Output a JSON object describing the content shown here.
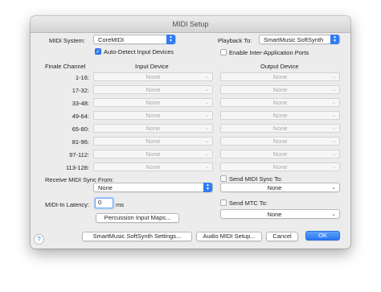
{
  "window": {
    "title": "MIDI Setup"
  },
  "top": {
    "midi_system_label": "MIDI System:",
    "midi_system_value": "CoreMIDI",
    "auto_detect_label": "Auto-Detect Input Devices",
    "auto_detect_checked": true,
    "playback_to_label": "Playback To:",
    "playback_to_value": "SmartMusic SoftSynth",
    "enable_iap_label": "Enable Inter-Application Ports",
    "enable_iap_checked": false
  },
  "table": {
    "col_channel": "Finale Channel",
    "col_input": "Input Device",
    "col_output": "Output Device",
    "rows": [
      {
        "channel": "1-16:",
        "input": "None",
        "output": "None"
      },
      {
        "channel": "17-32:",
        "input": "None",
        "output": "None"
      },
      {
        "channel": "33-48:",
        "input": "None",
        "output": "None"
      },
      {
        "channel": "49-64:",
        "input": "None",
        "output": "None"
      },
      {
        "channel": "65-80:",
        "input": "None",
        "output": "None"
      },
      {
        "channel": "81-96:",
        "input": "None",
        "output": "None"
      },
      {
        "channel": "97-112:",
        "input": "None",
        "output": "None"
      },
      {
        "channel": "113-128:",
        "input": "None",
        "output": "None"
      }
    ]
  },
  "sync": {
    "receive_label": "Receive MIDI Sync From:",
    "receive_value": "None",
    "send_sync_label": "Send MIDI Sync To:",
    "send_sync_value": "None",
    "latency_label": "MIDI-In Latency:",
    "latency_value": "0",
    "latency_unit": "ms",
    "send_mtc_label": "Send MTC To:",
    "send_mtc_value": "None",
    "percussion_button": "Percussion Input Maps..."
  },
  "footer": {
    "help": "?",
    "softsynth_button": "SmartMusic SoftSynth Settings...",
    "audio_midi_button": "Audio MIDI Setup...",
    "cancel_button": "Cancel",
    "ok_button": "OK"
  },
  "colors": {
    "accent": "#2f7cf6",
    "window_bg": "#ececec"
  }
}
